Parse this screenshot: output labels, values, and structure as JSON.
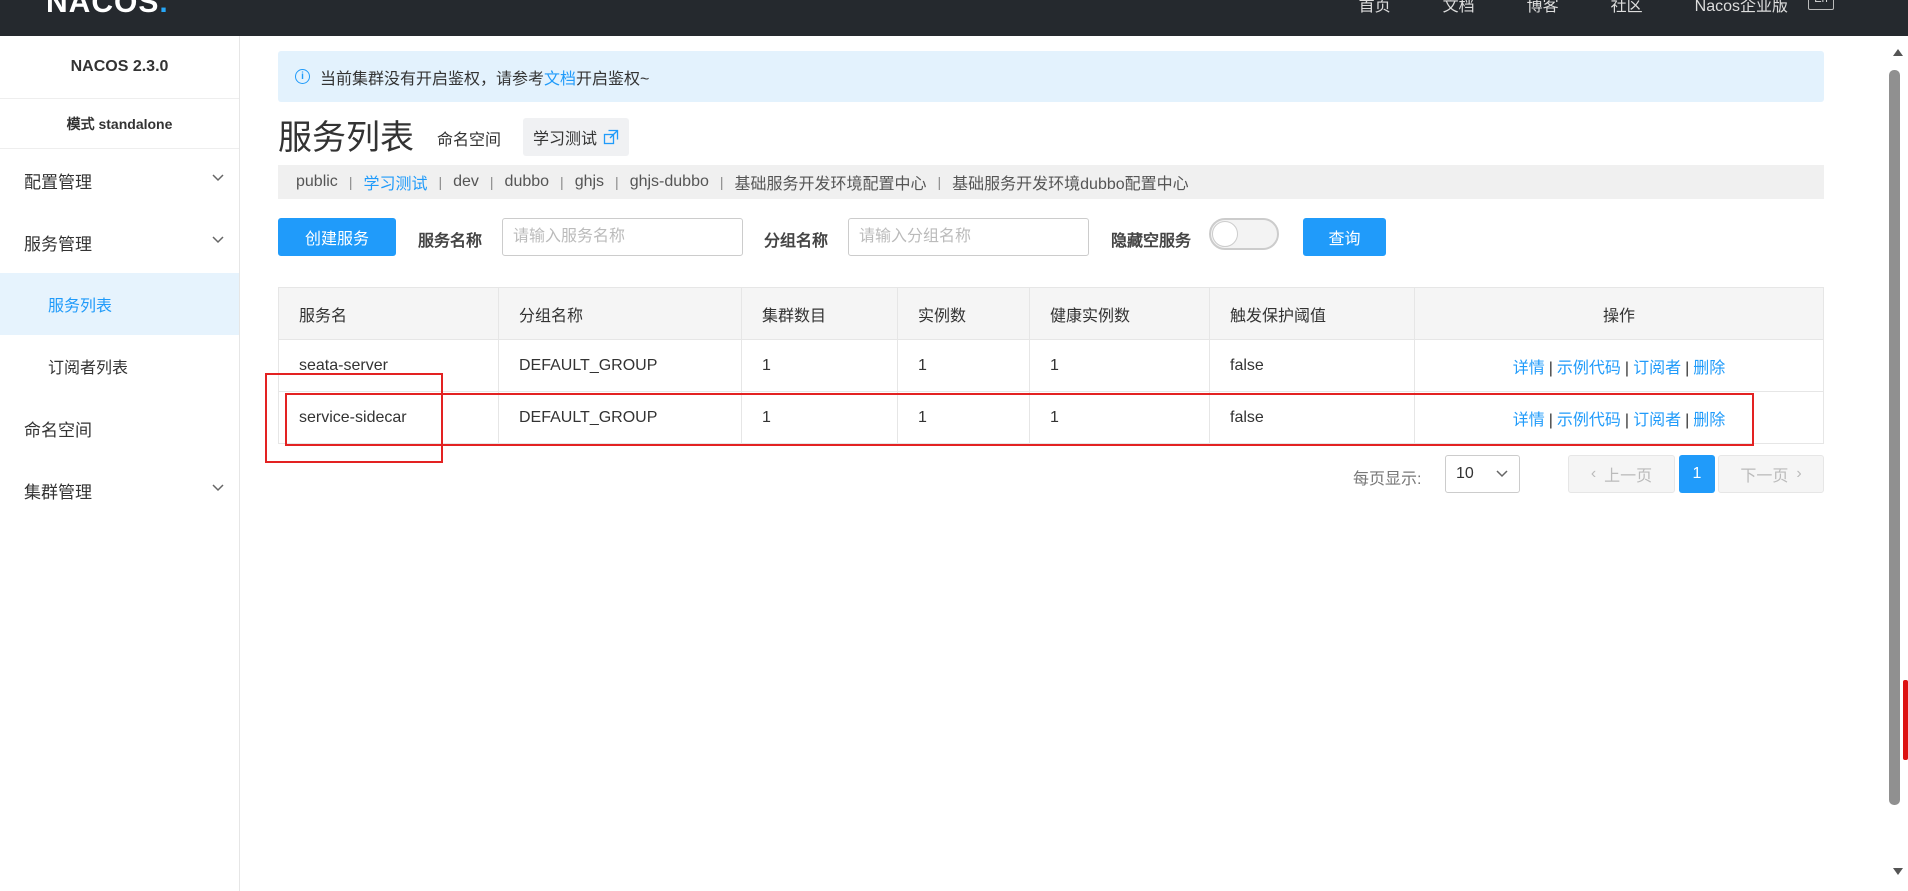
{
  "topbar": {
    "logo_text": "NACOS",
    "logo_dot": ".",
    "nav": [
      "首页",
      "文档",
      "博客",
      "社区",
      "Nacos企业版"
    ],
    "lang": "En"
  },
  "sidebar": {
    "version": "NACOS 2.3.0",
    "mode": "模式 standalone",
    "items": [
      {
        "label": "配置管理"
      },
      {
        "label": "服务管理"
      },
      {
        "label": "服务列表"
      },
      {
        "label": "订阅者列表"
      },
      {
        "label": "命名空间"
      },
      {
        "label": "集群管理"
      }
    ]
  },
  "notice": {
    "text_before": "当前集群没有开启鉴权，请参考",
    "link": "文档",
    "text_after": "开启鉴权~"
  },
  "page": {
    "title": "服务列表",
    "namespace_label": "命名空间",
    "namespace_value": "学习测试"
  },
  "namespaces": [
    "public",
    "学习测试",
    "dev",
    "dubbo",
    "ghjs",
    "ghjs-dubbo",
    "基础服务开发环境配置中心",
    "基础服务开发环境dubbo配置中心"
  ],
  "toolbar": {
    "create_label": "创建服务",
    "service_name_label": "服务名称",
    "service_name_placeholder": "请输入服务名称",
    "group_name_label": "分组名称",
    "group_name_placeholder": "请输入分组名称",
    "hide_empty_label": "隐藏空服务",
    "query_label": "查询"
  },
  "table": {
    "headers": [
      "服务名",
      "分组名称",
      "集群数目",
      "实例数",
      "健康实例数",
      "触发保护阈值",
      "操作"
    ],
    "rows": [
      {
        "name": "seata-server",
        "group": "DEFAULT_GROUP",
        "clusters": "1",
        "instances": "1",
        "healthy": "1",
        "threshold": "false"
      },
      {
        "name": "service-sidecar",
        "group": "DEFAULT_GROUP",
        "clusters": "1",
        "instances": "1",
        "healthy": "1",
        "threshold": "false"
      }
    ],
    "ops": {
      "detail": "详情",
      "sample": "示例代码",
      "subscriber": "订阅者",
      "delete": "删除",
      "separator": "|"
    }
  },
  "pagination": {
    "per_page_label": "每页显示:",
    "page_size": "10",
    "prev": "上一页",
    "next": "下一页",
    "current": "1"
  },
  "colors": {
    "accent": "#209bfa",
    "topbar": "#25292e",
    "highlight": "#e32222"
  }
}
